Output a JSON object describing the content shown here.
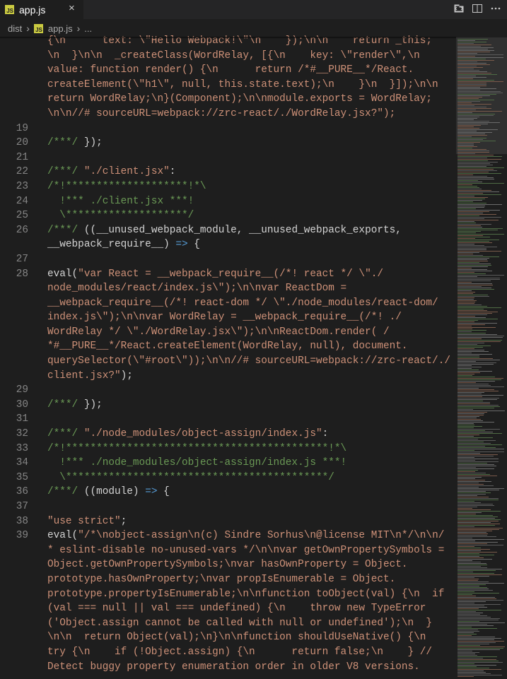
{
  "tab": {
    "icon": "js-file-icon",
    "badge": "JS",
    "label": "app.js",
    "close": "×"
  },
  "breadcrumb": {
    "folder": "dist",
    "file": "app.js",
    "more": "..."
  },
  "actions": [
    "compare-changes-icon",
    "split-editor-icon",
    "more-actions-icon"
  ],
  "colors": {
    "comment": "#6a9955",
    "string": "#ce9178",
    "text": "#d4d4d4",
    "keyword": "#569cd6",
    "line_number": "#858585"
  },
  "lines": [
    {
      "ln": "",
      "segs": [
        {
          "t": "{\\n      text: \\\"Hello Webpack!\\\"\\n    });\\n\\n    return _this;",
          "c": "str"
        }
      ]
    },
    {
      "ln": "",
      "segs": [
        {
          "t": "\\n  }\\n\\n  _createClass(WordRelay, [{\\n    key: \\\"render\\\",\\n",
          "c": "str"
        }
      ]
    },
    {
      "ln": "",
      "segs": [
        {
          "t": "value: function render() {\\n      return /*#__PURE__*/React.",
          "c": "str"
        }
      ]
    },
    {
      "ln": "",
      "segs": [
        {
          "t": "createElement(\\\"h1\\\", null, this.state.text);\\n    }\\n  }]);\\n\\n",
          "c": "str"
        }
      ]
    },
    {
      "ln": "",
      "segs": [
        {
          "t": "return WordRelay;\\n}(Component);\\n\\nmodule.exports = WordRelay;",
          "c": "str"
        }
      ]
    },
    {
      "ln": "",
      "segs": [
        {
          "t": "\\n\\n//# sourceURL=webpack://zrc-react/./WordRelay.jsx?\");",
          "c": "str"
        }
      ]
    },
    {
      "ln": "19",
      "segs": []
    },
    {
      "ln": "20",
      "segs": [
        {
          "t": "/***/",
          "c": "com"
        },
        {
          "t": " });",
          "c": "txt"
        }
      ]
    },
    {
      "ln": "21",
      "segs": []
    },
    {
      "ln": "22",
      "segs": [
        {
          "t": "/***/",
          "c": "com"
        },
        {
          "t": " ",
          "c": "txt"
        },
        {
          "t": "\"./client.jsx\"",
          "c": "str"
        },
        {
          "t": ":",
          "c": "txt"
        }
      ]
    },
    {
      "ln": "23",
      "segs": [
        {
          "t": "/*!********************!*\\",
          "c": "com"
        }
      ]
    },
    {
      "ln": "24",
      "segs": [
        {
          "t": "  !*** ./client.jsx ***!",
          "c": "com"
        }
      ]
    },
    {
      "ln": "25",
      "segs": [
        {
          "t": "  \\********************/",
          "c": "com"
        }
      ]
    },
    {
      "ln": "26",
      "segs": [
        {
          "t": "/***/",
          "c": "com"
        },
        {
          "t": " ((__unused_webpack_module, __unused_webpack_exports,",
          "c": "txt"
        }
      ]
    },
    {
      "ln": "",
      "segs": [
        {
          "t": "__webpack_require__) ",
          "c": "txt"
        },
        {
          "t": "=>",
          "c": "kw"
        },
        {
          "t": " {",
          "c": "txt"
        }
      ]
    },
    {
      "ln": "27",
      "segs": []
    },
    {
      "ln": "28",
      "segs": [
        {
          "t": "eval(",
          "c": "txt"
        },
        {
          "t": "\"var React = __webpack_require__(/*! react */ \\\"./",
          "c": "str"
        }
      ]
    },
    {
      "ln": "",
      "segs": [
        {
          "t": "node_modules/react/index.js\\\");\\n\\nvar ReactDom =",
          "c": "str"
        }
      ]
    },
    {
      "ln": "",
      "segs": [
        {
          "t": "__webpack_require__(/*! react-dom */ \\\"./node_modules/react-dom/",
          "c": "str"
        }
      ]
    },
    {
      "ln": "",
      "segs": [
        {
          "t": "index.js\\\");\\n\\nvar WordRelay = __webpack_require__(/*! ./",
          "c": "str"
        }
      ]
    },
    {
      "ln": "",
      "segs": [
        {
          "t": "WordRelay */ \\\"./WordRelay.jsx\\\");\\n\\nReactDom.render( /",
          "c": "str"
        }
      ]
    },
    {
      "ln": "",
      "segs": [
        {
          "t": "*#__PURE__*/React.createElement(WordRelay, null), document.",
          "c": "str"
        }
      ]
    },
    {
      "ln": "",
      "segs": [
        {
          "t": "querySelector(\\\"#root\\\"));\\n\\n//# sourceURL=webpack://zrc-react/./",
          "c": "str"
        }
      ]
    },
    {
      "ln": "",
      "segs": [
        {
          "t": "client.jsx?\"",
          "c": "str"
        },
        {
          "t": ");",
          "c": "txt"
        }
      ]
    },
    {
      "ln": "29",
      "segs": []
    },
    {
      "ln": "30",
      "segs": [
        {
          "t": "/***/",
          "c": "com"
        },
        {
          "t": " });",
          "c": "txt"
        }
      ]
    },
    {
      "ln": "31",
      "segs": []
    },
    {
      "ln": "32",
      "segs": [
        {
          "t": "/***/",
          "c": "com"
        },
        {
          "t": " ",
          "c": "txt"
        },
        {
          "t": "\"./node_modules/object-assign/index.js\"",
          "c": "str"
        },
        {
          "t": ":",
          "c": "txt"
        }
      ]
    },
    {
      "ln": "33",
      "segs": [
        {
          "t": "/*!*******************************************!*\\",
          "c": "com"
        }
      ]
    },
    {
      "ln": "34",
      "segs": [
        {
          "t": "  !*** ./node_modules/object-assign/index.js ***!",
          "c": "com"
        }
      ]
    },
    {
      "ln": "35",
      "segs": [
        {
          "t": "  \\*******************************************/",
          "c": "com"
        }
      ]
    },
    {
      "ln": "36",
      "segs": [
        {
          "t": "/***/",
          "c": "com"
        },
        {
          "t": " ((module) ",
          "c": "txt"
        },
        {
          "t": "=>",
          "c": "kw"
        },
        {
          "t": " {",
          "c": "txt"
        }
      ]
    },
    {
      "ln": "37",
      "segs": []
    },
    {
      "ln": "38",
      "segs": [
        {
          "t": "\"use strict\"",
          "c": "str"
        },
        {
          "t": ";",
          "c": "txt"
        }
      ]
    },
    {
      "ln": "39",
      "segs": [
        {
          "t": "eval(",
          "c": "txt"
        },
        {
          "t": "\"/*\\nobject-assign\\n(c) Sindre Sorhus\\n@license MIT\\n*/\\n\\n/",
          "c": "str"
        }
      ]
    },
    {
      "ln": "",
      "segs": [
        {
          "t": "* eslint-disable no-unused-vars */\\n\\nvar getOwnPropertySymbols =",
          "c": "str"
        }
      ]
    },
    {
      "ln": "",
      "segs": [
        {
          "t": "Object.getOwnPropertySymbols;\\nvar hasOwnProperty = Object.",
          "c": "str"
        }
      ]
    },
    {
      "ln": "",
      "segs": [
        {
          "t": "prototype.hasOwnProperty;\\nvar propIsEnumerable = Object.",
          "c": "str"
        }
      ]
    },
    {
      "ln": "",
      "segs": [
        {
          "t": "prototype.propertyIsEnumerable;\\n\\nfunction toObject(val) {\\n  if",
          "c": "str"
        }
      ]
    },
    {
      "ln": "",
      "segs": [
        {
          "t": "(val === null || val === undefined) {\\n    throw new TypeError",
          "c": "str"
        }
      ]
    },
    {
      "ln": "",
      "segs": [
        {
          "t": "('Object.assign cannot be called with null or undefined');\\n  }",
          "c": "str"
        }
      ]
    },
    {
      "ln": "",
      "segs": [
        {
          "t": "\\n\\n  return Object(val);\\n}\\n\\nfunction shouldUseNative() {\\n",
          "c": "str"
        }
      ]
    },
    {
      "ln": "",
      "segs": [
        {
          "t": "try {\\n    if (!Object.assign) {\\n      return false;\\n    } //",
          "c": "str"
        }
      ]
    },
    {
      "ln": "",
      "segs": [
        {
          "t": "Detect buggy property enumeration order in older V8 versions.",
          "c": "str"
        }
      ]
    }
  ]
}
